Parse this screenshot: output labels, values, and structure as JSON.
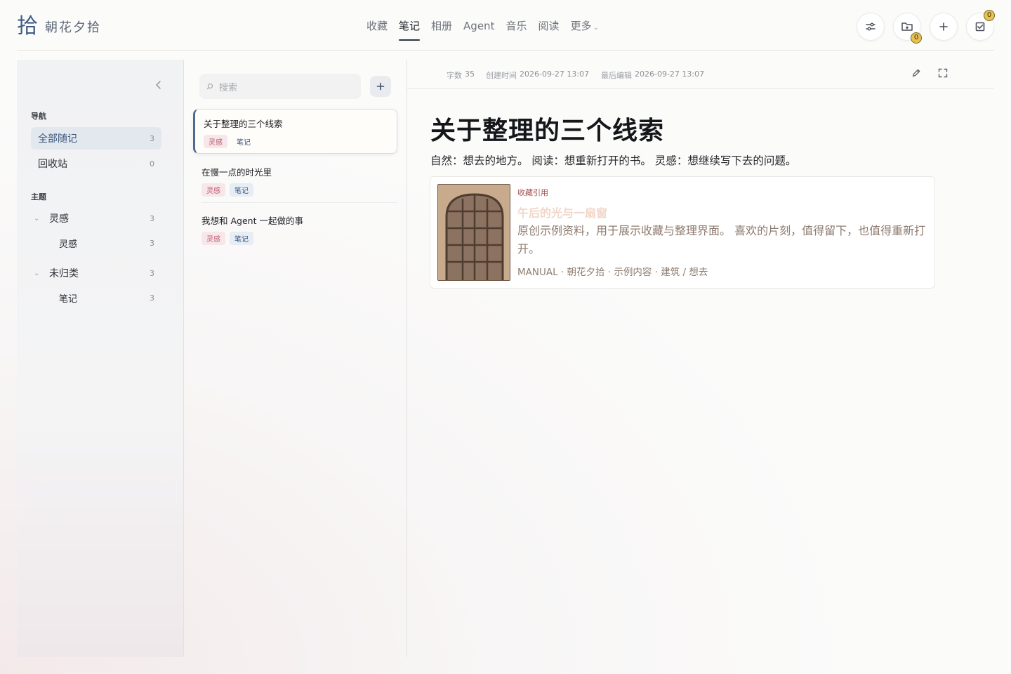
{
  "app": {
    "logo_mark": "拾",
    "name": "朝花夕拾"
  },
  "nav": {
    "items": [
      {
        "label": "收藏"
      },
      {
        "label": "笔记"
      },
      {
        "label": "相册"
      },
      {
        "label": "Agent"
      },
      {
        "label": "音乐"
      },
      {
        "label": "阅读"
      },
      {
        "label": "更多"
      }
    ],
    "active": "笔记"
  },
  "top_actions": {
    "folder_badge": "0",
    "tasks_badge": "0"
  },
  "sidebar": {
    "nav_title": "导航",
    "nav_items": [
      {
        "label": "全部随记",
        "count": "3"
      },
      {
        "label": "回收站",
        "count": "0"
      }
    ],
    "topic_title": "主题",
    "topics": [
      {
        "label": "灵感",
        "count": "3",
        "child": {
          "label": "灵感",
          "count": "3"
        }
      },
      {
        "label": "未归类",
        "count": "3",
        "child": {
          "label": "笔记",
          "count": "3"
        }
      }
    ]
  },
  "list": {
    "search_placeholder": "搜索",
    "notes": [
      {
        "title": "关于整理的三个线索",
        "tags": [
          "灵感",
          "笔记"
        ]
      },
      {
        "title": "在慢一点的时光里",
        "tags": [
          "灵感",
          "笔记"
        ]
      },
      {
        "title": "我想和 Agent 一起做的事",
        "tags": [
          "灵感",
          "笔记"
        ]
      }
    ]
  },
  "detail": {
    "meta": {
      "words_label": "字数",
      "words": "35",
      "created_label": "创建时间",
      "created": "2026-09-27 13:07",
      "edited_label": "最后编辑",
      "edited": "2026-09-27 13:07"
    },
    "title": "关于整理的三个线索",
    "body": "自然：想去的地方。 阅读：想重新打开的书。 灵感：想继续写下去的问题。",
    "quote": {
      "label": "收藏引用",
      "title": "午后的光与一扇窗",
      "desc": "原创示例资料，用于展示收藏与整理界面。 喜欢的片刻，值得留下，也值得重新打开。",
      "source": "MANUAL · 朝花夕拾 · 示例内容 · 建筑 / 想去"
    }
  },
  "icons": {
    "settings": "sliders-icon",
    "folder": "folder-icon",
    "add": "plus-icon",
    "tasks": "checkbox-icon",
    "collapse": "chevron-left-icon",
    "edit": "pencil-icon",
    "fullscreen": "expand-icon"
  },
  "colors": {
    "accent": "#3e5c86",
    "badge": "#e8c14e",
    "tag_red": "#b85a6c",
    "tag_blue": "#3b557c"
  }
}
